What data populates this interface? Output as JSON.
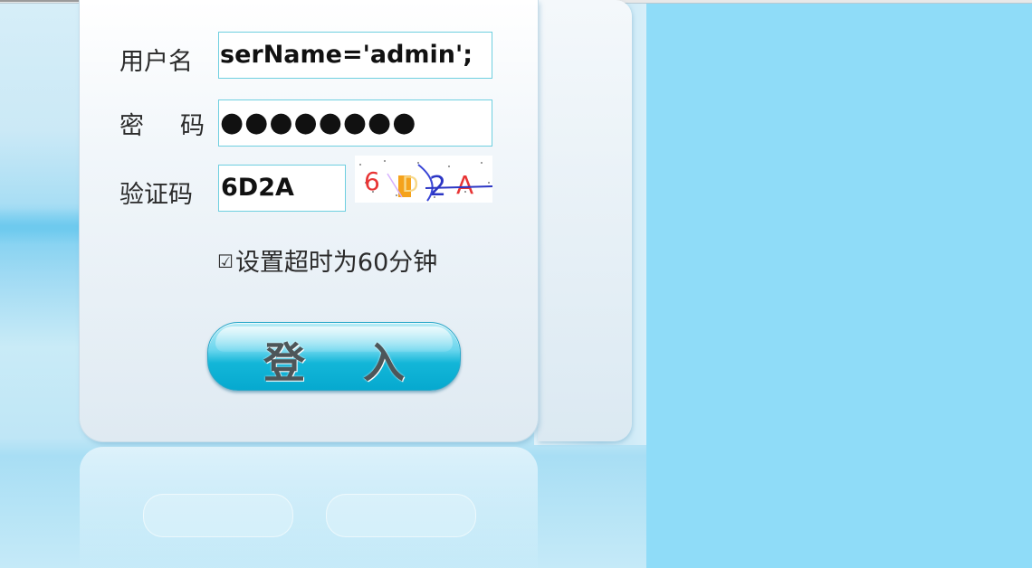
{
  "form": {
    "username_label": "用户名",
    "username_value": "serName='admin';",
    "password_label_a": "密",
    "password_label_b": "码",
    "password_value": "●●●●●●●●",
    "captcha_label": "验证码",
    "captcha_value": "6D2A",
    "captcha_image_text": "6D2A",
    "remember_checkbox": "☑",
    "remember_label": "设置超时为60分钟",
    "login_button": "登 入"
  },
  "colors": {
    "background": "#8fdcf8",
    "field_border": "#6fcfe0",
    "button": "#13b6d8"
  }
}
